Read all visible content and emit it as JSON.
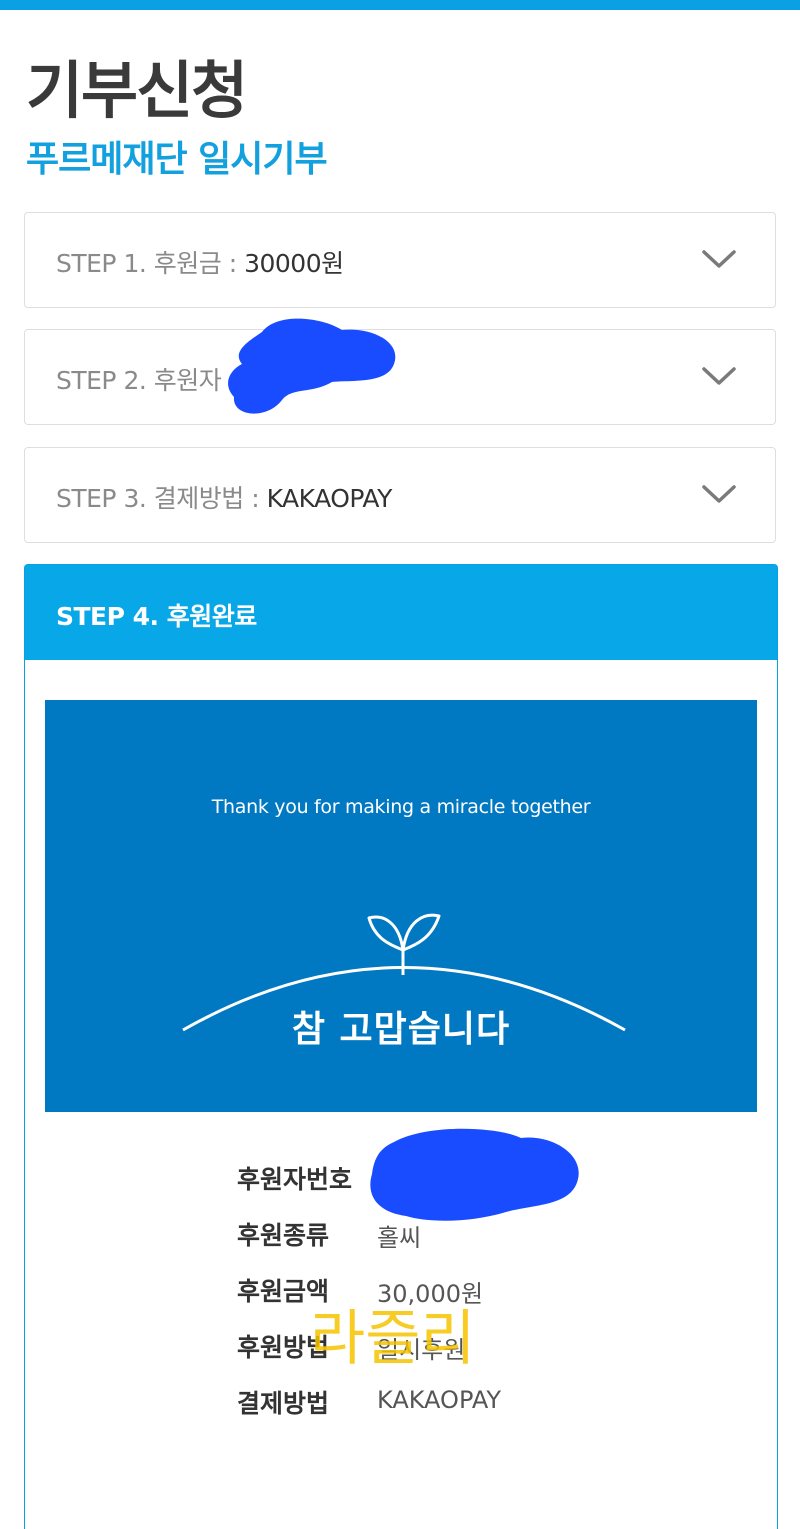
{
  "page": {
    "title": "기부신청",
    "subtitle": "푸르메재단 일시기부"
  },
  "steps": [
    {
      "label": "STEP 1. 후원금 : ",
      "value": "30000원"
    },
    {
      "label": "STEP 2. 후원자",
      "value": ""
    },
    {
      "label": "STEP 3. 결제방법 : ",
      "value": "KAKAOPAY"
    }
  ],
  "step4": {
    "title": "STEP 4. 후원완료",
    "banner": {
      "english": "Thank you for making a miracle together",
      "korean": "참 고맙습니다"
    },
    "info": [
      {
        "label": "후원자번호",
        "value": ""
      },
      {
        "label": "후원종류",
        "value": "홀씨"
      },
      {
        "label": "후원금액",
        "value": "30,000원"
      },
      {
        "label": "후원방법",
        "value": "일시후원"
      },
      {
        "label": "결제방법",
        "value": "KAKAOPAY"
      }
    ]
  },
  "watermark": "라즐리",
  "colors": {
    "accent": "#0aa0e3",
    "banner": "#0078c2",
    "redaction": "#1a4cff",
    "watermark": "#f5c400"
  },
  "icons": {
    "step_toggle": "chevron-down-icon",
    "sprout": "sprout-icon"
  }
}
